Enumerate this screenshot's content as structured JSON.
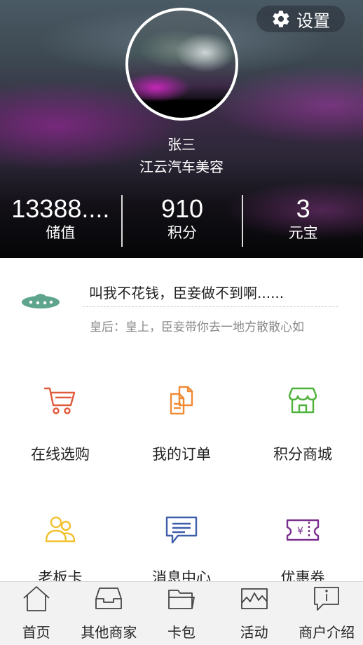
{
  "header": {
    "settings_label": "设置",
    "user_name": "张三",
    "shop_name": "江云汽车美容",
    "stats": [
      {
        "value": "13388....",
        "label": "储值"
      },
      {
        "value": "910",
        "label": "积分"
      },
      {
        "value": "3",
        "label": "元宝"
      }
    ]
  },
  "notice": {
    "title": "叫我不花钱，臣妾做不到啊......",
    "subtitle": "皇后：皇上，臣妾带你去一地方散散心如"
  },
  "grid": {
    "items": [
      {
        "label": "在线选购",
        "icon": "cart-icon",
        "color": "#e05a3c"
      },
      {
        "label": "我的订单",
        "icon": "order-document-icon",
        "color": "#f08a35"
      },
      {
        "label": "积分商城",
        "icon": "store-icon",
        "color": "#4fb23a"
      },
      {
        "label": "老板卡",
        "icon": "people-icon",
        "color": "#f2c12e"
      },
      {
        "label": "消息中心",
        "icon": "message-icon",
        "color": "#3f5faa"
      },
      {
        "label": "优惠券",
        "icon": "coupon-icon",
        "color": "#7b2f8e"
      }
    ]
  },
  "bottom_nav": {
    "items": [
      {
        "label": "首页",
        "icon": "home-icon"
      },
      {
        "label": "其他商家",
        "icon": "inbox-tray-icon"
      },
      {
        "label": "卡包",
        "icon": "folder-icon"
      },
      {
        "label": "活动",
        "icon": "activity-chart-icon"
      },
      {
        "label": "商户介绍",
        "icon": "info-bubble-icon"
      }
    ]
  },
  "colors": {
    "ufo": "#5fa58e",
    "divider": "#cfcfcf",
    "nav_background": "#f2f2f2"
  }
}
